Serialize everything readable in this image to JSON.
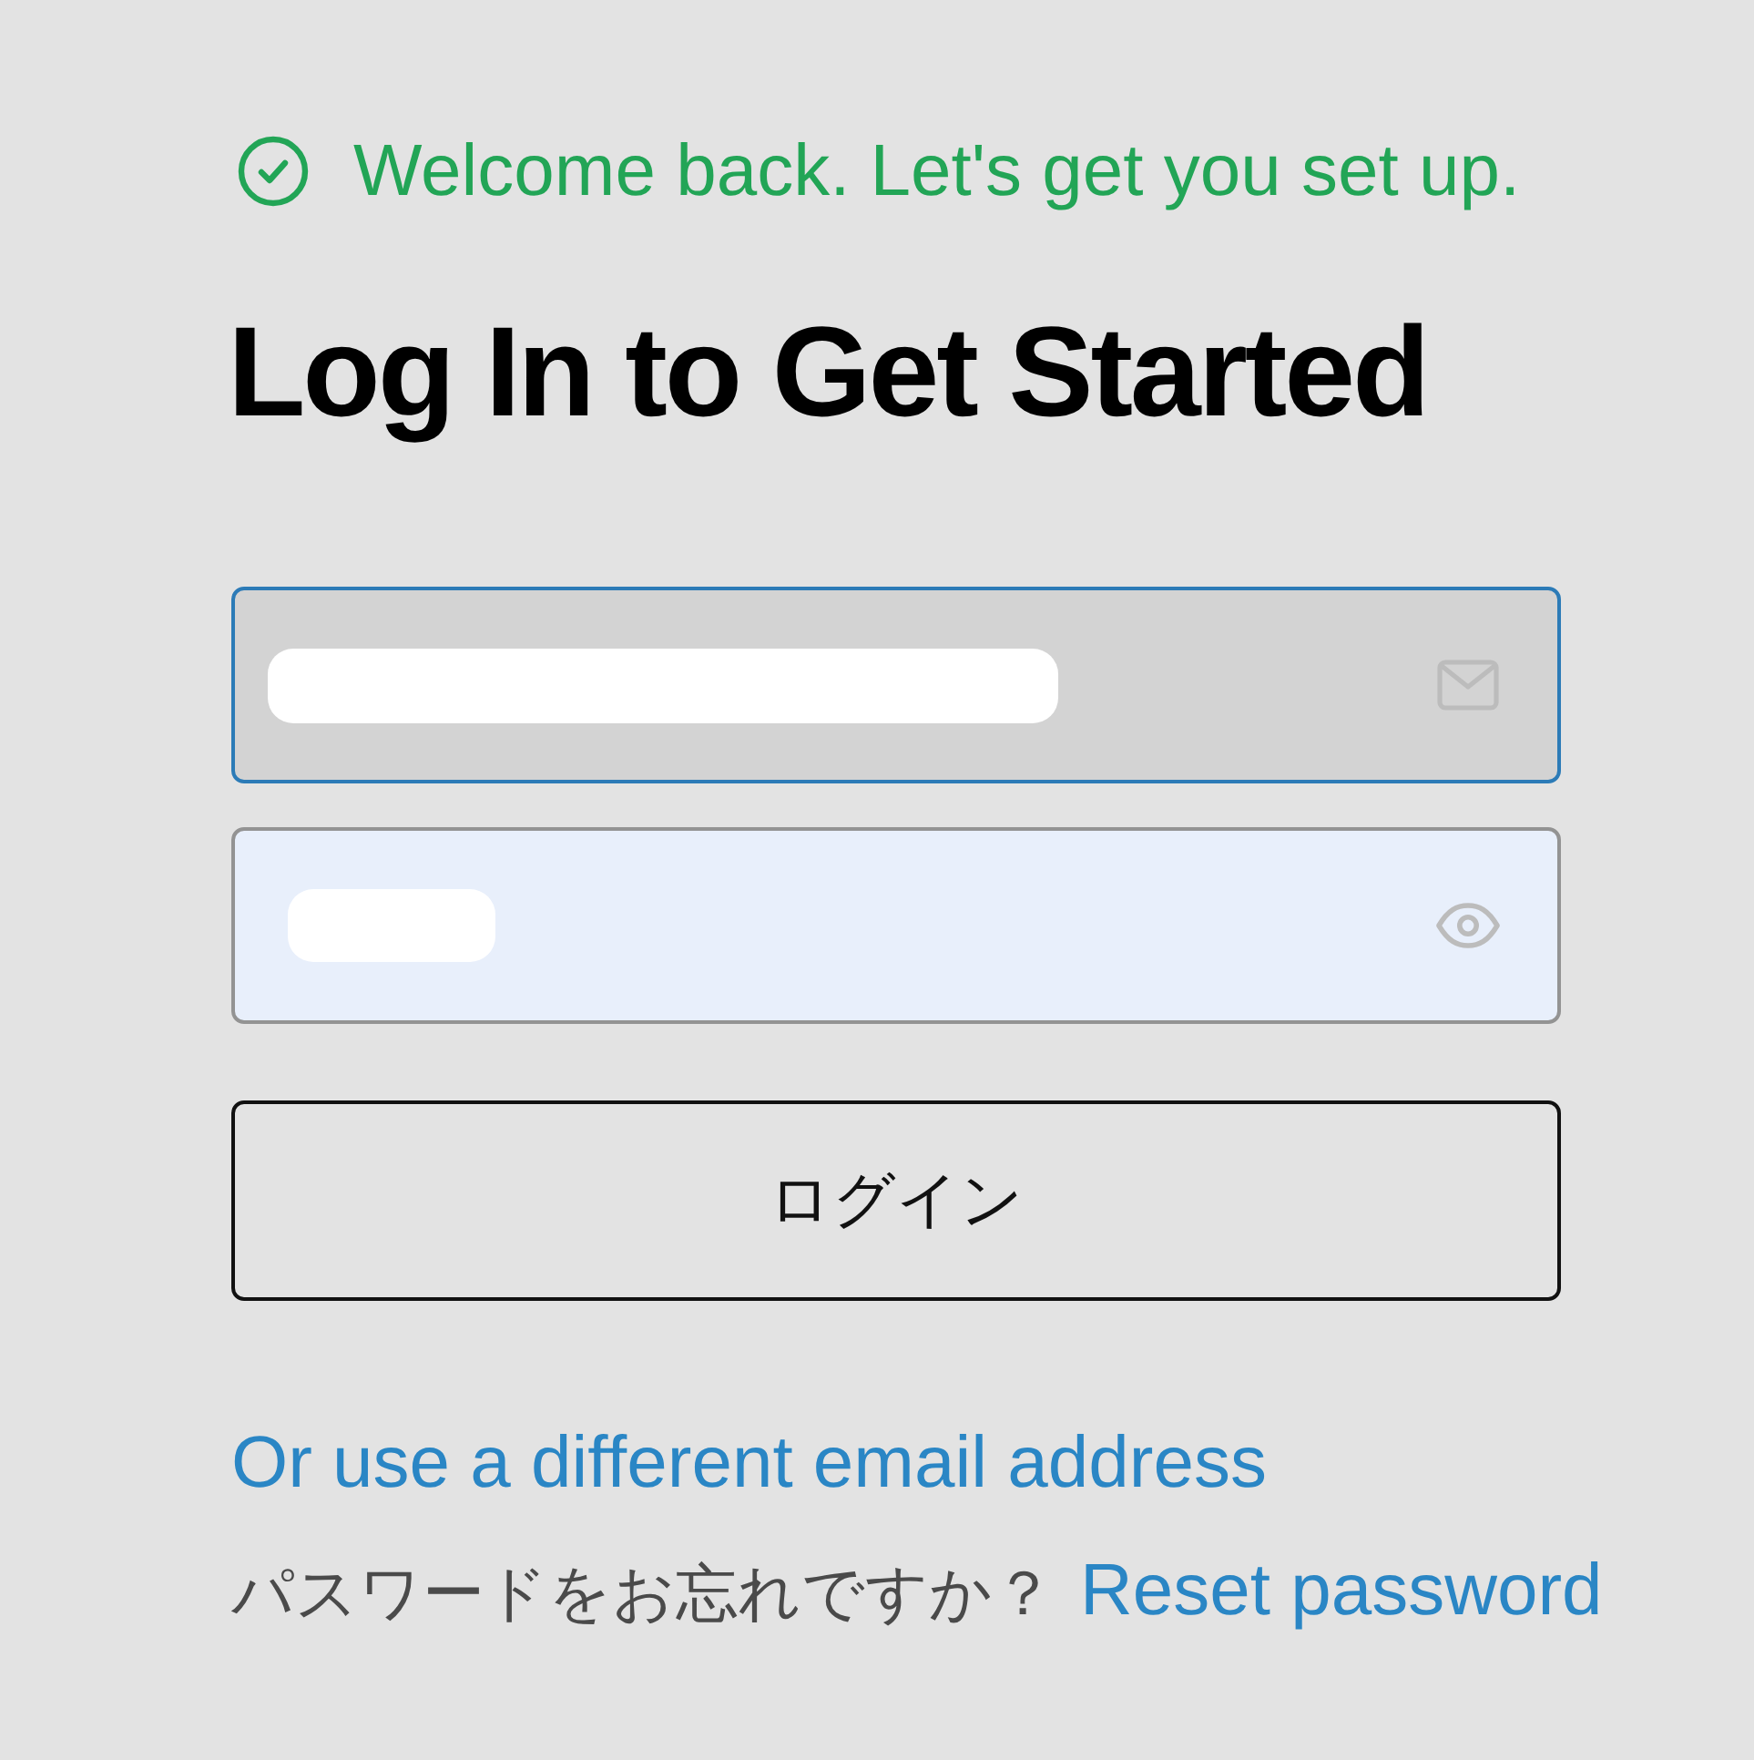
{
  "status_message": "Welcome back. Let's get you set up.",
  "heading": "Log In to Get Started",
  "fields": [
    {
      "kind": "email",
      "focused": true,
      "autofilled": false,
      "value_hidden": true
    },
    {
      "kind": "password",
      "focused": false,
      "autofilled": true,
      "value_hidden": true
    }
  ],
  "login_button": "ログイン",
  "alt_email_link": "Or use a different email address",
  "forgot_prompt": "パスワードをお忘れですか？",
  "reset_link": "Reset password"
}
